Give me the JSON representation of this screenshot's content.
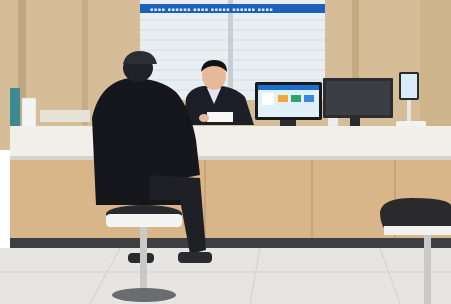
{
  "scene": {
    "kind": "photo",
    "icons": [
      "service-counter",
      "person-seated-customer",
      "person-staff",
      "touchscreen-kiosk",
      "monitor",
      "tablet-stand",
      "bar-stool"
    ],
    "colors": {
      "wall": "#d6bf9a",
      "counter_top": "#f1efe9",
      "counter_panel": "#d9b68a",
      "floor": "#e6e5e1",
      "jacket": "#15171c",
      "stool_seat": "#2a2a2d",
      "screen_accent": "#1b6fd1"
    }
  }
}
